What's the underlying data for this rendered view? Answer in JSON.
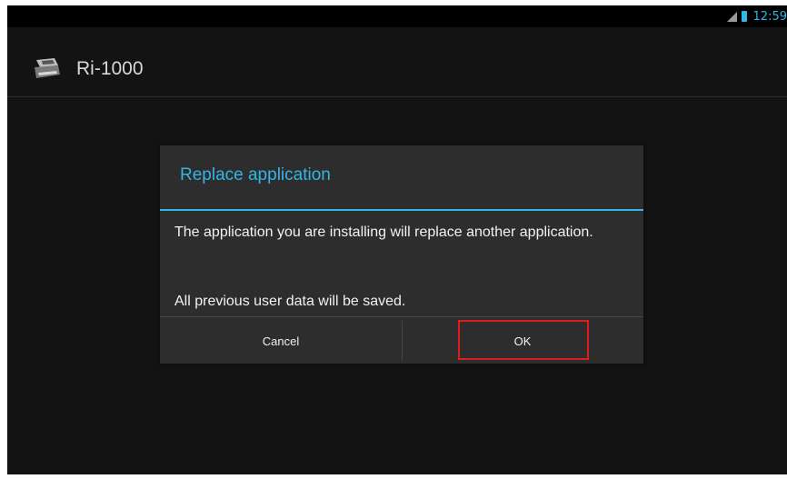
{
  "status_bar": {
    "time": "12:59",
    "icons": [
      "signal-icon",
      "battery-icon"
    ]
  },
  "action_bar": {
    "app_title": "Ri-1000",
    "app_icon": "printer-icon"
  },
  "dialog": {
    "title": "Replace application",
    "message": "The application you are installing will replace another application.",
    "note": "All previous user data will be saved.",
    "buttons": {
      "cancel": "Cancel",
      "ok": "OK"
    }
  },
  "colors": {
    "accent": "#33b5e5",
    "background": "#131313",
    "dialog": "#2d2d2d",
    "highlight": "#e01b1b"
  }
}
